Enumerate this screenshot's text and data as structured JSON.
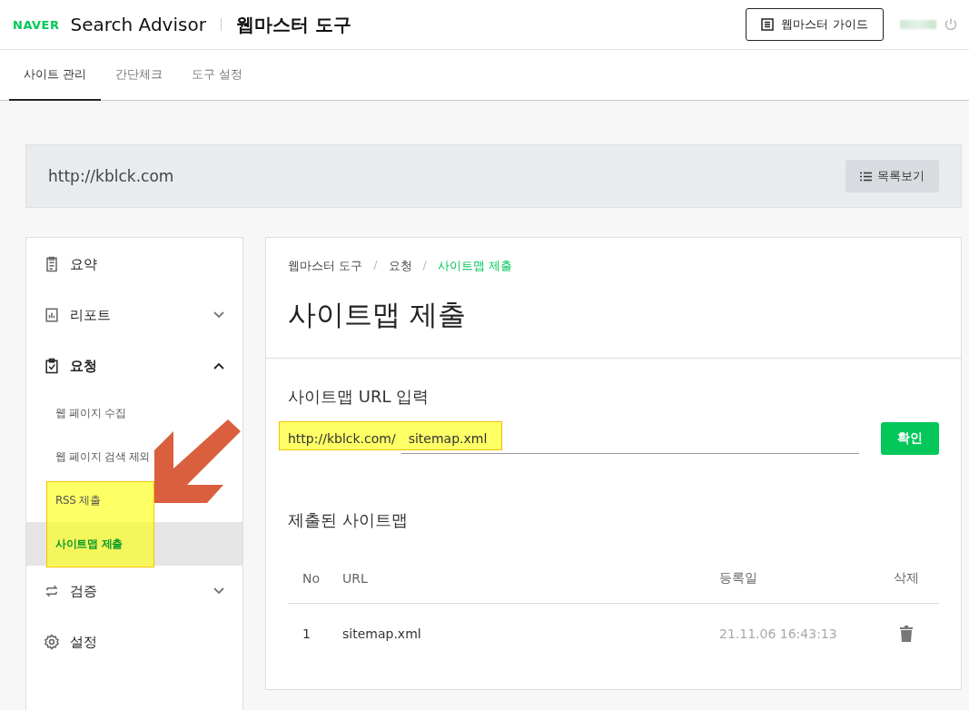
{
  "header": {
    "brand": "NAVER",
    "product": "Search Advisor",
    "section": "웹마스터 도구",
    "guide_button": "웹마스터 가이드"
  },
  "tabs": [
    {
      "label": "사이트 관리",
      "selected": true
    },
    {
      "label": "간단체크",
      "selected": false
    },
    {
      "label": "도구 설정",
      "selected": false
    }
  ],
  "site_bar": {
    "url": "http://kblck.com",
    "list_button": "목록보기"
  },
  "sidebar": {
    "items": [
      {
        "label": "요약"
      },
      {
        "label": "리포트",
        "expanded": false
      },
      {
        "label": "요청",
        "expanded": true,
        "children": [
          {
            "label": "웹 페이지 수집",
            "selected": false
          },
          {
            "label": "웹 페이지 검색 제외",
            "selected": false
          },
          {
            "label": "RSS 제출",
            "selected": false
          },
          {
            "label": "사이트맵 제출",
            "selected": true
          }
        ]
      },
      {
        "label": "검증",
        "expanded": false
      },
      {
        "label": "설정"
      }
    ]
  },
  "breadcrumb": {
    "items": [
      "웹마스터 도구",
      "요청",
      "사이트맵 제출"
    ],
    "separators": [
      "/",
      "/"
    ]
  },
  "page_title": "사이트맵 제출",
  "url_form": {
    "heading": "사이트맵 URL 입력",
    "prefix": "http://kblck.com/",
    "value": "sitemap.xml",
    "submit": "확인"
  },
  "submitted": {
    "heading": "제출된 사이트맵",
    "columns": [
      "No",
      "URL",
      "등록일",
      "삭제"
    ],
    "rows": [
      {
        "no": "1",
        "url": "sitemap.xml",
        "date": "21.11.06 16:43:13"
      }
    ]
  }
}
